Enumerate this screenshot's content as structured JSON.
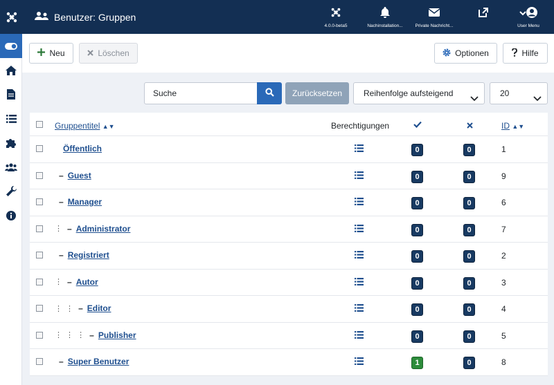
{
  "header": {
    "title": "Benutzer: Gruppen",
    "items": [
      {
        "label": "4.0.0-beta5",
        "icon": "joomla-icon"
      },
      {
        "label": "Nachinstallation...",
        "icon": "bell-icon"
      },
      {
        "label": "Private Nachricht...",
        "icon": "envelope-icon"
      },
      {
        "label": "",
        "icon": "external-link-icon"
      },
      {
        "label": "User Menu",
        "icon": "user-icon"
      }
    ]
  },
  "toolbar": {
    "new_label": "Neu",
    "delete_label": "Löschen",
    "options_label": "Optionen",
    "help_label": "Hilfe"
  },
  "filters": {
    "search_placeholder": "Suche",
    "reset_label": "Zurücksetzen",
    "ordering": "Reihenfolge aufsteigend",
    "limit": "20"
  },
  "table": {
    "columns": {
      "title": "Gruppentitel",
      "permissions": "Berechtigungen",
      "id": "ID"
    },
    "rows": [
      {
        "dots": "",
        "dash": "",
        "name": "Öffentlich",
        "active": "0",
        "blocked": "0",
        "id": "1"
      },
      {
        "dots": "",
        "dash": "–",
        "name": "Guest",
        "active": "0",
        "blocked": "0",
        "id": "9"
      },
      {
        "dots": "",
        "dash": "–",
        "name": "Manager",
        "active": "0",
        "blocked": "0",
        "id": "6"
      },
      {
        "dots": "⋮",
        "dash": "–",
        "name": "Administrator",
        "active": "0",
        "blocked": "0",
        "id": "7"
      },
      {
        "dots": "",
        "dash": "–",
        "name": "Registriert",
        "active": "0",
        "blocked": "0",
        "id": "2"
      },
      {
        "dots": "⋮",
        "dash": "–",
        "name": "Autor",
        "active": "0",
        "blocked": "0",
        "id": "3"
      },
      {
        "dots": "⋮ ⋮",
        "dash": "–",
        "name": "Editor",
        "active": "0",
        "blocked": "0",
        "id": "4"
      },
      {
        "dots": "⋮ ⋮ ⋮",
        "dash": "–",
        "name": "Publisher",
        "active": "0",
        "blocked": "0",
        "id": "5"
      },
      {
        "dots": "",
        "dash": "–",
        "name": "Super Benutzer",
        "active": "1",
        "blocked": "0",
        "id": "8"
      }
    ]
  },
  "colors": {
    "header_bg": "#132f53",
    "accent": "#2a69b8",
    "badge_dark": "#183a62",
    "badge_green": "#2d8c3b"
  }
}
